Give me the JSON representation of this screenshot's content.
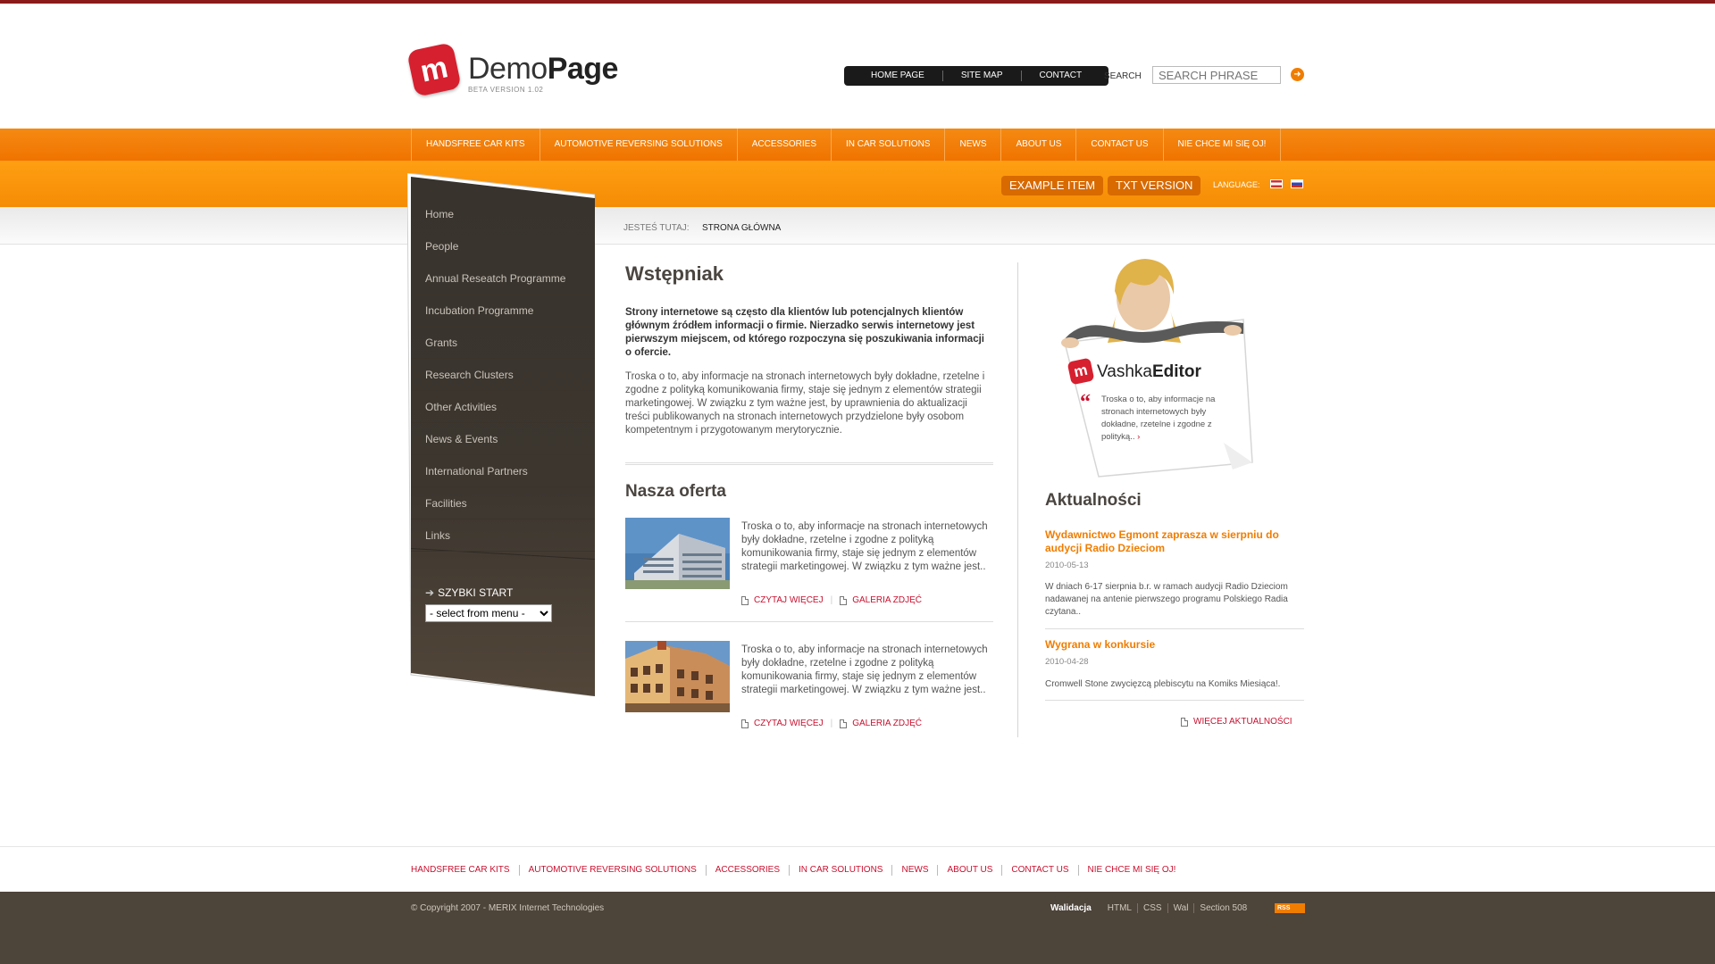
{
  "brand": {
    "logo_letter": "m",
    "name_light": "Demo",
    "name_bold": "Page",
    "version": "BETA VERSION 1.02"
  },
  "topnav": [
    "HOME PAGE",
    "SITE MAP",
    "CONTACT"
  ],
  "search": {
    "label": "SEARCH",
    "placeholder": "SEARCH PHRASE"
  },
  "mainnav": [
    "HANDSFREE CAR KITS",
    "AUTOMOTIVE REVERSING SOLUTIONS",
    "ACCESSORIES",
    "IN CAR SOLUTIONS",
    "NEWS",
    "ABOUT US",
    "CONTACT US",
    "NIE CHCE MI SIĘ OJ!"
  ],
  "subbar": {
    "example_item": "EXAMPLE ITEM",
    "txt_version": "TXT VERSION",
    "language_label": "LANGUAGE:"
  },
  "breadcrumb": {
    "label": "JESTEŚ TUTAJ:",
    "current": "STRONA GŁÓWNA"
  },
  "sidebar": {
    "items": [
      "Home",
      "People",
      "Annual Reseatch Programme",
      "Incubation Programme",
      "Grants",
      "Research Clusters",
      "Other Activities",
      "News & Events",
      "International Partners",
      "Facilities",
      "Links"
    ],
    "quick_start_title": "SZYBKI START",
    "quick_start_value": "- select from menu -"
  },
  "main": {
    "title": "Wstępniak",
    "lead": "Strony internetowe są często dla klientów lub potencjalnych klientów głównym źródłem informacji o firmie. Nierzadko serwis internetowy jest pierwszym miejscem, od którego rozpoczyna się poszukiwania informacji o ofercie.",
    "paragraph": "Troska o to, aby informacje na stronach internetowych były dokładne, rzetelne i zgodne z polityką komunikowania firmy, staje się jednym z elementów strategii marketingowej. W związku z tym ważne jest, by uprawnienia do aktualizacji treści publikowanych na stronach internetowych przydzielone były osobom kompetentnym i przygotowanym merytorycznie.",
    "offer_title": "Nasza oferta",
    "offers": [
      {
        "text": "Troska o to, aby informacje na stronach internetowych były dokładne, rzetelne i zgodne z polityką komunikowania firmy, staje się jednym z elementów strategii marketingowej. W związku z tym ważne jest..",
        "read_more": "CZYTAJ WIĘCEJ",
        "gallery": "GALERIA ZDJĘĆ"
      },
      {
        "text": "Troska o to, aby informacje na stronach internetowych były dokładne, rzetelne i zgodne z polityką komunikowania firmy, staje się jednym z elementów strategii marketingowej. W związku z tym ważne jest..",
        "read_more": "CZYTAJ WIĘCEJ",
        "gallery": "GALERIA ZDJĘĆ"
      }
    ]
  },
  "editor": {
    "name_light": "Vashka",
    "name_bold": "Editor",
    "quote": "Troska o to, aby informacje na stronach internetowych były dokładne, rzetelne i zgodne z polityką..",
    "quote_mark": "“"
  },
  "news": {
    "title": "Aktualności",
    "items": [
      {
        "title": "Wydawnictwo Egmont zaprasza w sierpniu do audycji Radio Dzieciom",
        "date": "2010-05-13",
        "body": "W dniach 6-17 sierpnia b.r. w ramach audycji Radio Dzieciom nadawanej na antenie pierwszego programu Polskiego Radia czytana.."
      },
      {
        "title": "Wygrana w konkursie",
        "date": "2010-04-28",
        "body": "Cromwell Stone zwycięzcą plebiscytu na Komiks Miesiąca!."
      }
    ],
    "more": "WIĘCEJ AKTUALNOŚCI"
  },
  "footer": {
    "nav": [
      "HANDSFREE CAR KITS",
      "AUTOMOTIVE REVERSING SOLUTIONS",
      "ACCESSORIES",
      "IN CAR SOLUTIONS",
      "NEWS",
      "ABOUT US",
      "CONTACT US",
      "NIE CHCE MI SIĘ OJ!"
    ],
    "copyright": "© Copyright 2007 - MERIX Internet Technologies",
    "validation_label": "Walidacja",
    "validation_links": [
      "HTML",
      "CSS",
      "Wal",
      "Section 508"
    ],
    "rss": "RSS"
  },
  "colors": {
    "accent": "#f07d00",
    "link_red": "#c8102e",
    "sidebar_brown": "#3f3a34",
    "footer_brown": "#4d443a"
  }
}
